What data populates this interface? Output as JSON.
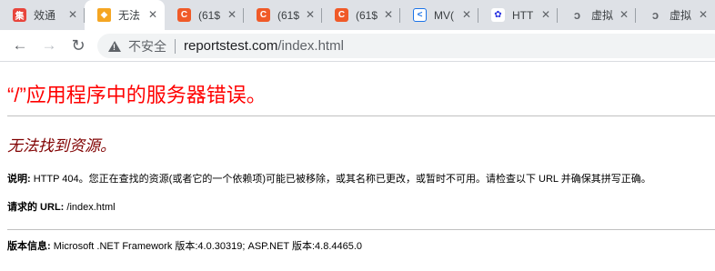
{
  "tabs": [
    {
      "title": "效通",
      "favicon_text": "集",
      "favicon_color": "#e8453c",
      "active": false
    },
    {
      "title": "无法",
      "favicon_text": "◆",
      "favicon_color": "#f5a623",
      "active": true
    },
    {
      "title": "(61$",
      "favicon_text": "C",
      "favicon_color": "#f05a28",
      "active": false
    },
    {
      "title": "(61$",
      "favicon_text": "C",
      "favicon_color": "#f05a28",
      "active": false
    },
    {
      "title": "(61$",
      "favicon_text": "C",
      "favicon_color": "#f05a28",
      "active": false
    },
    {
      "title": "MV(",
      "favicon_text": "<",
      "favicon_color": "#1a73e8",
      "active": false
    },
    {
      "title": "HTT",
      "favicon_text": "✿",
      "favicon_color": "#2932e1",
      "active": false
    },
    {
      "title": "虚拟",
      "favicon_text": "ↄ",
      "favicon_color": "#5f6368",
      "active": false
    },
    {
      "title": "虚拟",
      "favicon_text": "ↄ",
      "favicon_color": "#5f6368",
      "active": false
    }
  ],
  "toolbar": {
    "back_icon": "←",
    "forward_icon": "→",
    "reload_icon": "↻",
    "security_label": "不安全",
    "url_host": "reportstest.com",
    "url_path": "/index.html"
  },
  "page": {
    "heading": "“/”应用程序中的服务器错误。",
    "subheading": "无法找到资源。",
    "description_label": "说明:",
    "description_text": " HTTP 404。您正在查找的资源(或者它的一个依赖项)可能已被移除，或其名称已更改，或暂时不可用。请检查以下 URL 并确保其拼写正确。",
    "requested_url_label": "请求的 URL:",
    "requested_url_value": " /index.html",
    "version_label": "版本信息:",
    "version_text": " Microsoft .NET Framework 版本:4.0.30319; ASP.NET 版本:4.8.4465.0"
  },
  "colors": {
    "heading": "#ff0000",
    "subheading": "#800000",
    "tabstrip": "#dee1e6"
  }
}
